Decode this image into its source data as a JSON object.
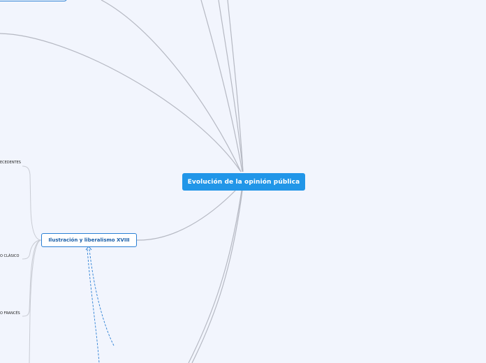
{
  "mindmap": {
    "central_topic": "Evolución de la opinión pública",
    "subtopic": "Ilustración y liberalismo XVIII",
    "leaves": [
      "ECEDENTES",
      "O CLÁSICO",
      "O FRANCÉS"
    ]
  },
  "colors": {
    "background": "#f2f5fd",
    "central_fill": "#2196e8",
    "subtopic_border": "#2a7fd4",
    "connector": "#b5b8c2",
    "dashed_link": "#2a7fd4"
  }
}
